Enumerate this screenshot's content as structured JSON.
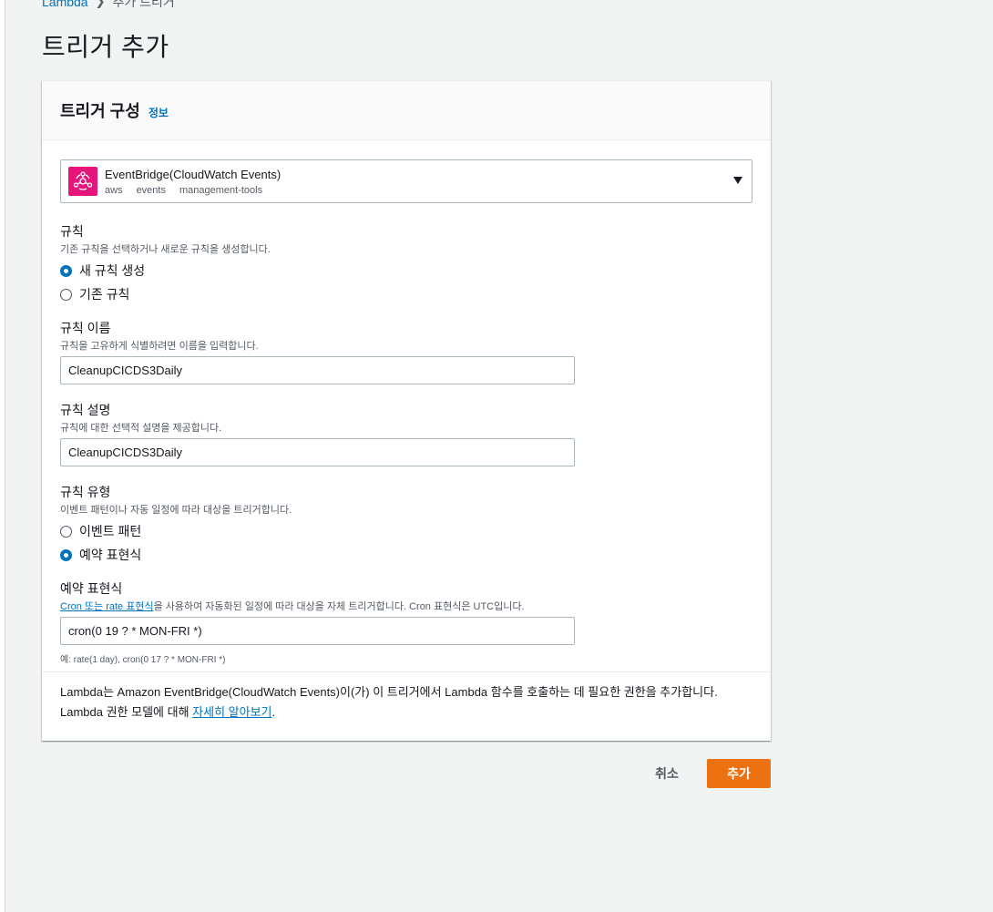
{
  "breadcrumb": {
    "root": "Lambda",
    "current": "추가 트리거"
  },
  "page_title": "트리거 추가",
  "card": {
    "title": "트리거 구성",
    "info_link": "정보",
    "trigger": {
      "name": "EventBridge(CloudWatch Events)",
      "tags": [
        "aws",
        "events",
        "management-tools"
      ],
      "icon": "eventbridge-icon",
      "icon_color": "#e7157b"
    },
    "rule": {
      "label": "규칙",
      "desc": "기존 규칙을 선택하거나 새로운 규칙을 생성합니다.",
      "options": [
        {
          "label": "새 규칙 생성",
          "checked": true
        },
        {
          "label": "기존 규칙",
          "checked": false
        }
      ]
    },
    "rule_name": {
      "label": "규칙 이름",
      "desc": "규칙을 고유하게 식별하려면 이름을 입력합니다.",
      "value": "CleanupCICDS3Daily"
    },
    "rule_description": {
      "label": "규칙 설명",
      "desc": "규칙에 대한 선택적 설명을 제공합니다.",
      "value": "CleanupCICDS3Daily"
    },
    "rule_type": {
      "label": "규칙 유형",
      "desc": "이벤트 패턴이나 자동 일정에 따라 대상을 트리거합니다.",
      "options": [
        {
          "label": "이벤트 패턴",
          "checked": false
        },
        {
          "label": "예약 표현식",
          "checked": true
        }
      ]
    },
    "schedule": {
      "label": "예약 표현식",
      "desc_link": "Cron 또는 rate 표현식",
      "desc_rest": "을 사용하여 자동화된 일정에 따라 대상을 자체 트리거합니다. Cron 표현식은 UTC입니다.",
      "value": "cron(0 19 ? * MON-FRI *)",
      "hint": "예: rate(1 day), cron(0 17 ? * MON-FRI *)"
    },
    "notice": {
      "text": "Lambda는 Amazon EventBridge(CloudWatch Events)이(가) 이 트리거에서 Lambda 함수를 호출하는 데 필요한 권한을 추가합니다. Lambda 권한 모델에 대해 ",
      "link": "자세히 알아보기",
      "end": "."
    }
  },
  "actions": {
    "cancel": "취소",
    "add": "추가"
  },
  "colors": {
    "primary": "#ec7211",
    "link": "#0073bb"
  }
}
